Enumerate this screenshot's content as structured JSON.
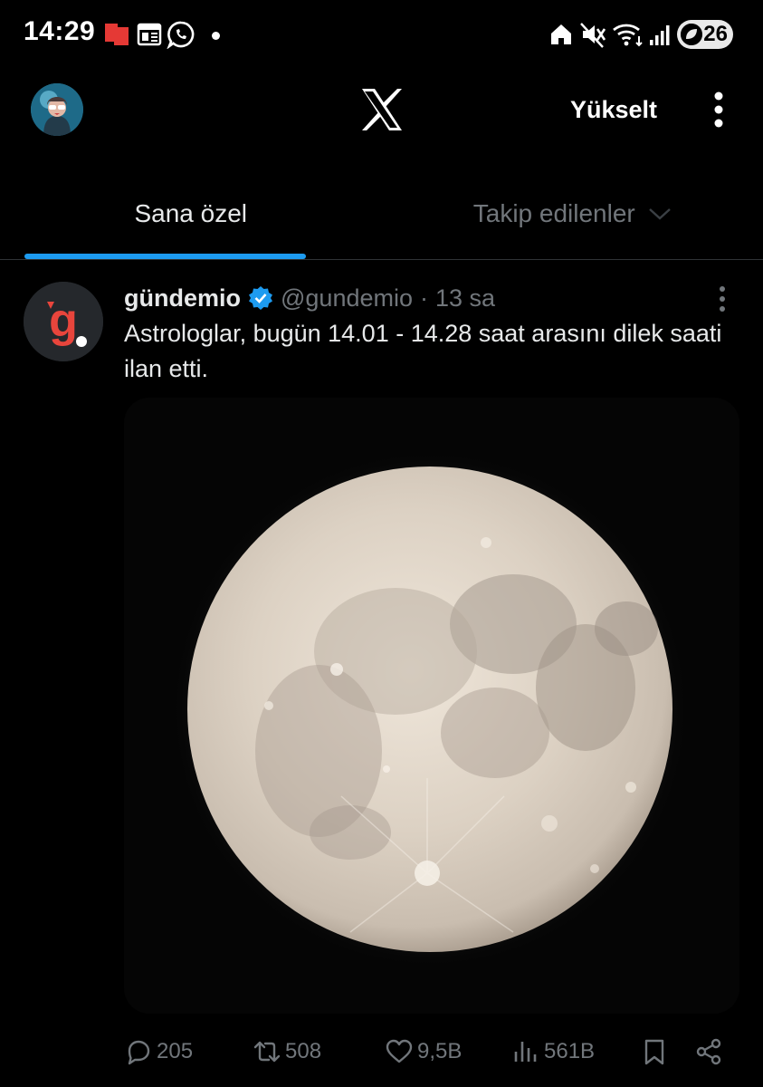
{
  "status_bar": {
    "time": "14:29",
    "battery_level": "26",
    "left_icons": [
      "red-notification-icon",
      "news-icon",
      "whatsapp-icon",
      "more-notifications-dot"
    ],
    "right_icons": [
      "home-icon",
      "mute-icon",
      "wifi-icon",
      "signal-icon",
      "battery-icon"
    ]
  },
  "header": {
    "logo": "x-logo-icon",
    "upgrade_label": "Yükselt",
    "more_icon": "vertical-ellipsis-icon"
  },
  "tabs": [
    {
      "label": "Sana özel",
      "active": true
    },
    {
      "label": "Takip edilenler",
      "active": false
    }
  ],
  "tweet": {
    "display_name": "gündemio",
    "verified": true,
    "handle": "@gundemio",
    "separator": "·",
    "time_ago": "13 sa",
    "text": "Astrologlar, bugün 14.01 - 14.28 saat arasını dilek saati ilan etti.",
    "media": "full-moon-photo",
    "actions": {
      "replies": "205",
      "retweets": "508",
      "likes": "9,5B",
      "views": "561B"
    }
  },
  "colors": {
    "background": "#000000",
    "text_primary": "#e7e9ea",
    "text_secondary": "#71767b",
    "accent": "#1d9bf0",
    "divider": "#2f3336",
    "brand_red": "#e8453c"
  }
}
